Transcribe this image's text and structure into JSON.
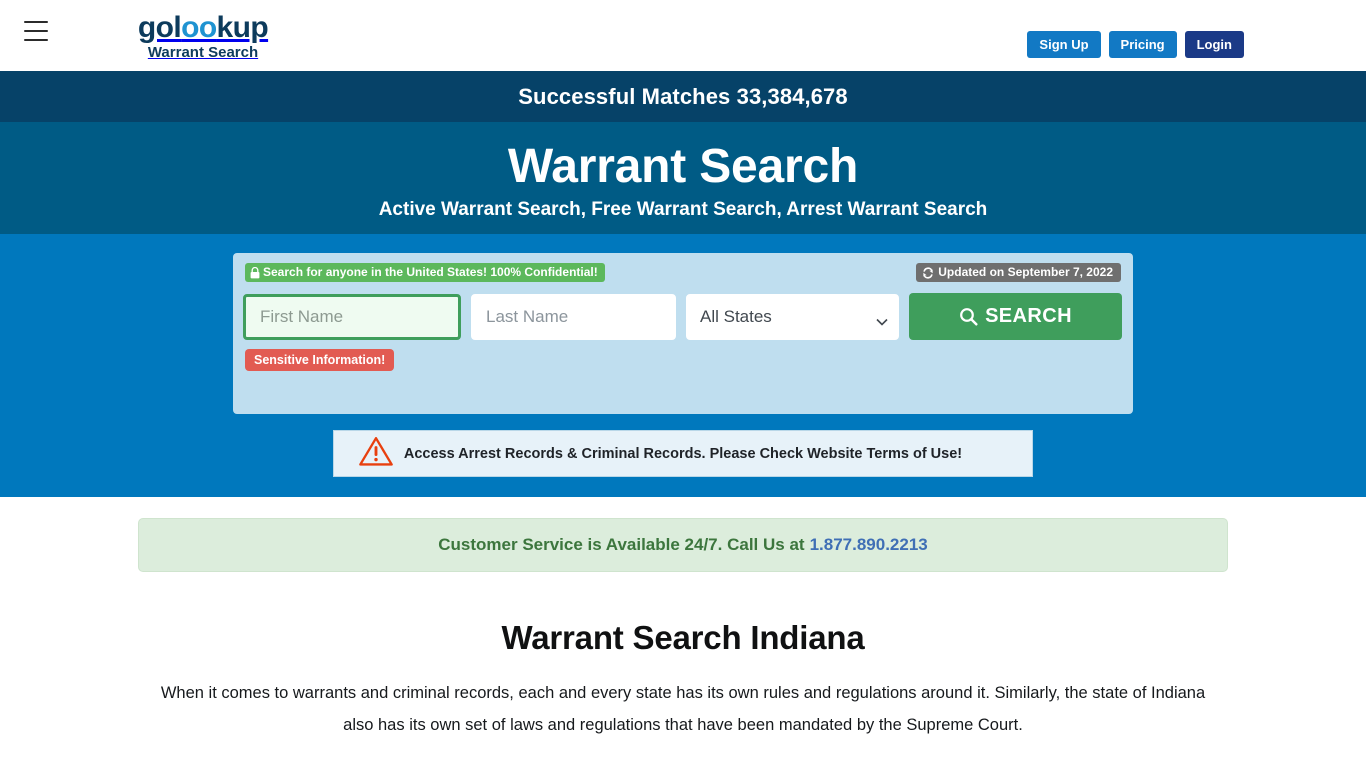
{
  "header": {
    "menu_icon": "hamburger-icon",
    "logo": {
      "part1": "gol",
      "part2": "oo",
      "part3": "kup",
      "tagline": "Warrant Search"
    },
    "buttons": [
      {
        "label": "Sign Up",
        "style": "light"
      },
      {
        "label": "Pricing",
        "style": "light"
      },
      {
        "label": "Login",
        "style": "dark"
      }
    ]
  },
  "matches_banner": {
    "text": "Successful Matches 33,384,678"
  },
  "hero": {
    "title": "Warrant Search",
    "subtitle": "Active Warrant Search, Free Warrant Search, Arrest Warrant Search"
  },
  "search_panel": {
    "confidential_badge": {
      "icon": "lock-icon",
      "label": "Search for anyone in the United States! 100% Confidential!"
    },
    "updated_badge": {
      "icon": "refresh-icon",
      "label": "Updated on September 7, 2022"
    },
    "first_name": {
      "value": "",
      "placeholder": "First Name"
    },
    "last_name": {
      "value": "",
      "placeholder": "Last Name"
    },
    "state_select": {
      "selected": "All States",
      "caret_icon": "chevron-down-icon"
    },
    "search_button": {
      "label": "SEARCH",
      "icon": "search-icon"
    },
    "sensitive_badge": {
      "label": "Sensitive Information!"
    }
  },
  "notice": {
    "icon": "warning-triangle-icon",
    "text": "Access Arrest Records & Criminal Records. Please Check Website Terms of Use!"
  },
  "customer_service": {
    "text": "Customer Service is Available 24/7. Call Us at",
    "phone": "1.877.890.2213"
  },
  "article": {
    "title": "Warrant Search Indiana",
    "paragraph": "When it comes to warrants and criminal records, each and every state has its own rules and regulations around it. Similarly, the state of Indiana also has its own set of laws and regulations that have been mandated by the Supreme Court."
  },
  "colors": {
    "banner_navy": "#064268",
    "hero_blue": "#005b85",
    "search_blue": "#0078bd",
    "panel_light_blue": "#bfdeef",
    "green_accent": "#3f9e5c",
    "red_accent": "#e25b52",
    "logo_navy": "#0d3b5c",
    "logo_blue": "#1f93d1"
  }
}
